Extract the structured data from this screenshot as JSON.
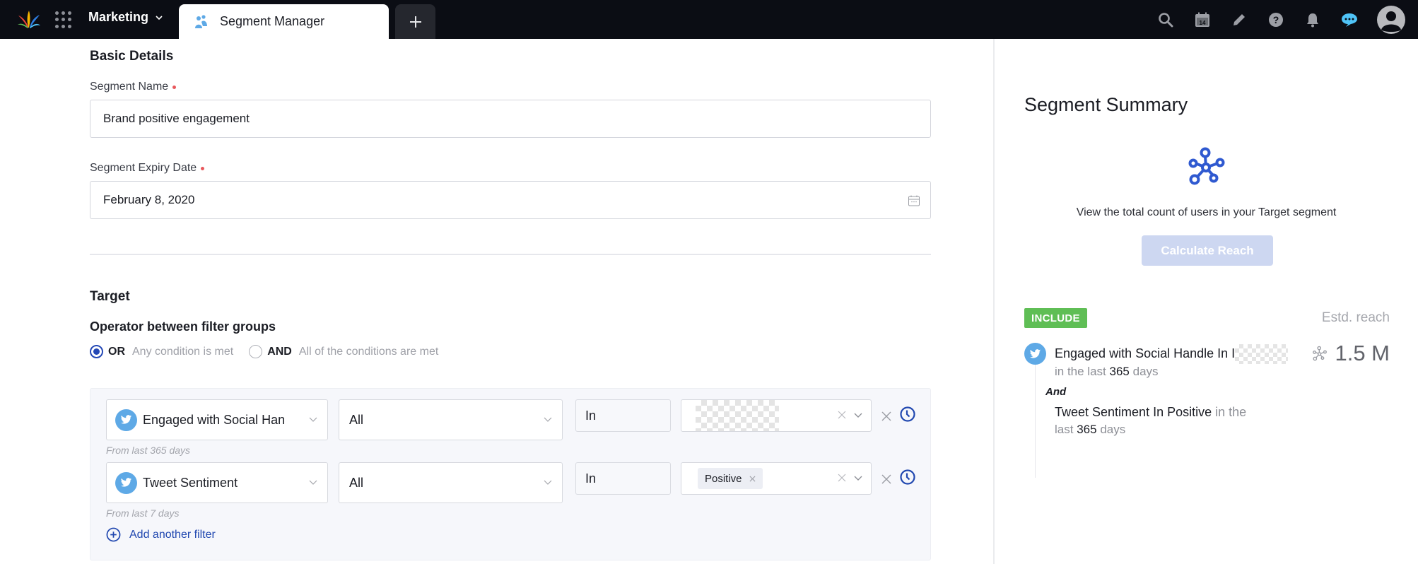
{
  "topbar": {
    "workspace": "Marketing",
    "active_tab": "Segment Manager",
    "icons": [
      "search-icon",
      "calendar-icon",
      "edit-icon",
      "help-icon",
      "notifications-icon",
      "chat-icon",
      "avatar"
    ],
    "calendar_day": "14",
    "chat_color": "#4fc3f7"
  },
  "basic": {
    "title": "Basic Details",
    "name_label": "Segment Name",
    "name_value": "Brand positive engagement",
    "expiry_label": "Segment Expiry Date",
    "expiry_value": "February 8, 2020"
  },
  "target": {
    "title": "Target",
    "operator_title": "Operator between filter groups",
    "options": [
      {
        "label": "OR",
        "desc": "Any condition is met",
        "checked": true
      },
      {
        "label": "AND",
        "desc": "All of the conditions are met",
        "checked": false
      }
    ],
    "filters": [
      {
        "attribute": "Engaged with Social Han",
        "scope": "All",
        "operator": "In",
        "value_chip": "",
        "hint": "From last 365 days"
      },
      {
        "attribute": "Tweet Sentiment",
        "scope": "All",
        "operator": "In",
        "value_chip": "Positive",
        "hint": "From last 7 days"
      }
    ],
    "add_filter": "Add another filter"
  },
  "summary": {
    "title": "Segment Summary",
    "desc": "View the total count of users in your Target segment",
    "calc_button": "Calculate Reach",
    "include_badge": "INCLUDE",
    "estd_label": "Estd. reach",
    "estd_value": "1.5 M",
    "cond1_title": "Engaged with Social Handle In I",
    "cond1_prefix": "in the last",
    "cond1_days": "365",
    "cond1_suffix": "days",
    "and_label": "And",
    "cond2_title": "Tweet Sentiment In Positive",
    "cond2_prefix": "in the",
    "cond2_prefix2": "last",
    "cond2_days": "365",
    "cond2_suffix": "days"
  },
  "colors": {
    "accent": "#2448b6",
    "include": "#5fbe55",
    "twitter": "#5ea9e6",
    "button_disabled": "#cdd7f1"
  }
}
